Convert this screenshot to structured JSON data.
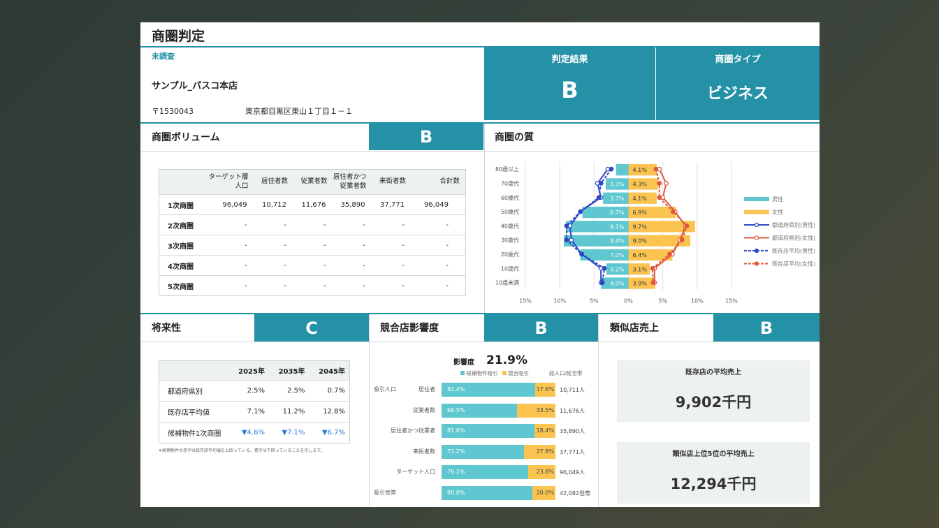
{
  "page": {
    "title": "商圏判定"
  },
  "store": {
    "status": "未調査",
    "name": "サンプル_パスコ本店",
    "postal": "〒1530043",
    "address": "東京都目黒区東山１丁目１－１"
  },
  "judgement": {
    "label": "判定結果",
    "value": "B"
  },
  "area_type": {
    "label": "商圏タイプ",
    "value": "ビジネス"
  },
  "volume": {
    "title": "商圏ボリューム",
    "grade": "B",
    "headers": [
      "",
      "ターゲット層人口",
      "居住者数",
      "従業者数",
      "居住者かつ従業者数",
      "来街者数",
      "合計数"
    ],
    "rows": [
      [
        "1次商圏",
        "96,049",
        "10,712",
        "11,676",
        "35,890",
        "37,771",
        "96,049"
      ],
      [
        "2次商圏",
        "-",
        "-",
        "-",
        "-",
        "-",
        "-"
      ],
      [
        "3次商圏",
        "-",
        "-",
        "-",
        "-",
        "-",
        "-"
      ],
      [
        "4次商圏",
        "-",
        "-",
        "-",
        "-",
        "-",
        "-"
      ],
      [
        "5次商圏",
        "-",
        "-",
        "-",
        "-",
        "-",
        "-"
      ]
    ]
  },
  "quality": {
    "title": "商圏の質"
  },
  "chart_data": {
    "type": "bar",
    "title": "",
    "categories": [
      "80歳以上",
      "70歳代",
      "60歳代",
      "50歳代",
      "40歳代",
      "30歳代",
      "20歳代",
      "10歳代",
      "10歳未満"
    ],
    "series": [
      {
        "name": "男性",
        "values": [
          1.8,
          3.3,
          3.7,
          6.7,
          9.1,
          9.4,
          7.0,
          3.2,
          4.0
        ],
        "labels": [
          "",
          "3.3%",
          "3.7%",
          "6.7%",
          "9.1%",
          "9.4%",
          "7.0%",
          "3.2%",
          "4.0%"
        ],
        "color": "#5ec7cf"
      },
      {
        "name": "女性",
        "values": [
          4.1,
          4.3,
          4.1,
          6.9,
          9.7,
          9.0,
          6.4,
          3.1,
          3.9
        ],
        "labels": [
          "4.1%",
          "4.3%",
          "4.1%",
          "6.9%",
          "9.7%",
          "9.0%",
          "6.4%",
          "3.1%",
          "3.9%"
        ],
        "color": "#fbc451"
      },
      {
        "name": "都道府県別(男性)",
        "values": [
          3.0,
          4.5,
          4.0,
          7.0,
          8.5,
          8.3,
          6.8,
          4.0,
          4.0
        ],
        "color": "#2e47c4"
      },
      {
        "name": "都道府県別(女性)",
        "values": [
          4.5,
          5.5,
          5.0,
          6.8,
          8.3,
          7.5,
          6.4,
          3.8,
          3.8
        ],
        "color": "#e05a3a"
      },
      {
        "name": "既存店平均(男性)",
        "values": [
          2.5,
          4.0,
          4.3,
          7.0,
          9.0,
          9.0,
          6.8,
          3.5,
          3.8
        ],
        "color": "#2e47c4"
      },
      {
        "name": "既存店平均(女性)",
        "values": [
          4.0,
          4.5,
          4.5,
          6.5,
          8.5,
          7.8,
          6.0,
          3.5,
          3.6
        ],
        "color": "#e05a3a"
      }
    ],
    "xticks": [
      "15%",
      "10%",
      "5%",
      "0%",
      "5%",
      "10%",
      "15%"
    ],
    "xlim": [
      -15,
      15
    ]
  },
  "future": {
    "title": "将来性",
    "grade": "C",
    "headers": [
      "",
      "2025年",
      "2035年",
      "2045年"
    ],
    "rows": [
      [
        "都道府県別",
        "2.5%",
        "2.5%",
        "0.7%"
      ],
      [
        "既存店平均値",
        "7.1%",
        "11.2%",
        "12.8%"
      ],
      [
        "候補物件1次商圏",
        "▼4.6%",
        "▼7.1%",
        "▼6.7%"
      ]
    ],
    "note": "※候補物件の赤字は既存店平均値を上回っている、青字は下回っていることを示します。"
  },
  "competition": {
    "title": "競合店影響度",
    "grade": "B",
    "impact_label": "影響度",
    "impact_value": "21.9%",
    "legend_a": "候補物件吸引",
    "legend_b": "競合吸引",
    "count_header": "総人口/総世帯",
    "group_pop": "吸引人口",
    "group_hh": "吸引世帯",
    "rows": [
      {
        "label": "居住者",
        "a": 82.4,
        "a_label": "82.4%",
        "b_label": "17.6%",
        "count": "10,711人"
      },
      {
        "label": "従業者数",
        "a": 66.5,
        "a_label": "66.5%",
        "b_label": "33.5%",
        "count": "11,676人"
      },
      {
        "label": "居住者かつ従業者",
        "a": 81.6,
        "a_label": "81.6%",
        "b_label": "18.4%",
        "count": "35,890人"
      },
      {
        "label": "来街者数",
        "a": 72.2,
        "a_label": "72.2%",
        "b_label": "27.8%",
        "count": "37,771人"
      },
      {
        "label": "ターゲット人口",
        "a": 76.2,
        "a_label": "76.2%",
        "b_label": "23.8%",
        "count": "96,049人"
      },
      {
        "label": "",
        "a": 80.0,
        "a_label": "80.0%",
        "b_label": "20.0%",
        "count": "42,082世帯"
      }
    ]
  },
  "similar_sales": {
    "title": "類似店売上",
    "grade": "B",
    "existing_caption": "既存店の平均売上",
    "existing_value": "9,902千円",
    "top5_caption": "類似店上位5位の平均売上",
    "top5_value": "12,294千円"
  }
}
